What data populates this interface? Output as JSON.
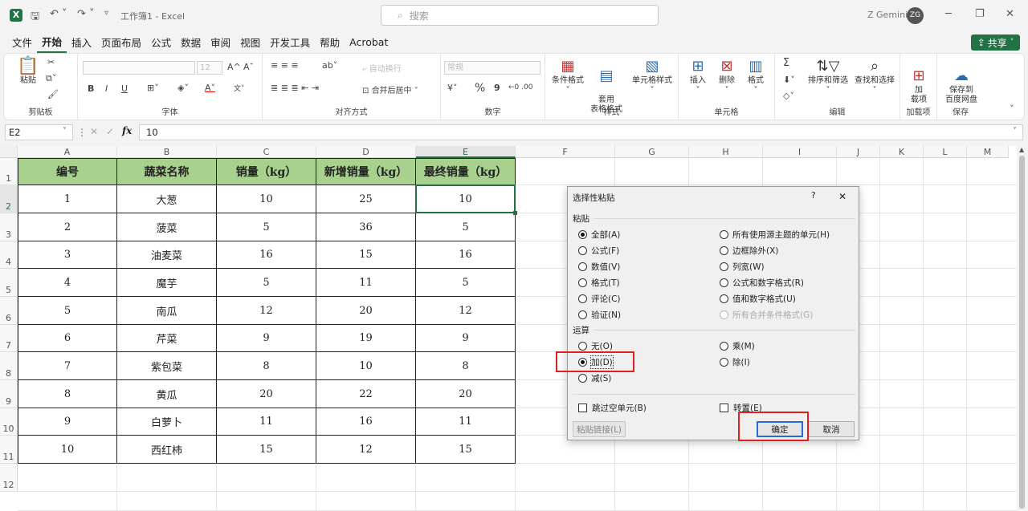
{
  "app": {
    "title": "工作簿1 - Excel",
    "search_placeholder": "搜索",
    "user_name": "Z Gemini",
    "user_initials": "ZG"
  },
  "menu": {
    "items": [
      "文件",
      "开始",
      "插入",
      "页面布局",
      "公式",
      "数据",
      "审阅",
      "视图",
      "开发工具",
      "帮助",
      "Acrobat"
    ],
    "active": "开始",
    "share": "共享"
  },
  "ribbon": {
    "clipboard": {
      "paste": "粘贴",
      "label": "剪贴板"
    },
    "font": {
      "size": "12",
      "label": "字体",
      "bold": "B",
      "italic": "I",
      "underline": "U",
      "increase": "A^",
      "decrease": "Aˇ"
    },
    "align": {
      "wrap": "自动换行",
      "merge": "合并后居中",
      "label": "对齐方式"
    },
    "number": {
      "format": "常规",
      "label": "数字",
      "percent": "%",
      "comma": "9"
    },
    "styles": {
      "cond": "条件格式",
      "table": "套用\n表格格式",
      "cell": "单元格样式",
      "label": "样式"
    },
    "cells": {
      "insert": "插入",
      "delete": "删除",
      "format": "格式",
      "label": "单元格"
    },
    "edit": {
      "sort": "排序和筛选",
      "find": "查找和选择",
      "label": "编辑",
      "sum": "Σ"
    },
    "addins": {
      "add": "加\n载项",
      "label": "加载项"
    },
    "save": {
      "save": "保存到\n百度网盘",
      "label": "保存"
    }
  },
  "formula": {
    "name": "E2",
    "value": "10",
    "fx": "fx"
  },
  "sheet": {
    "columns": [
      "A",
      "B",
      "C",
      "D",
      "E",
      "F",
      "G",
      "H",
      "I",
      "J",
      "K",
      "L",
      "M"
    ],
    "rows": [
      "1",
      "2",
      "3",
      "4",
      "5",
      "6",
      "7",
      "8",
      "9",
      "10",
      "11",
      "12"
    ],
    "headers": [
      "编号",
      "蔬菜名称",
      "销量（kg）",
      "新增销量（kg）",
      "最终销量（kg）"
    ],
    "data": [
      [
        "1",
        "大葱",
        "10",
        "25",
        "10"
      ],
      [
        "2",
        "菠菜",
        "5",
        "36",
        "5"
      ],
      [
        "3",
        "油麦菜",
        "16",
        "15",
        "16"
      ],
      [
        "4",
        "魔芋",
        "5",
        "11",
        "5"
      ],
      [
        "5",
        "南瓜",
        "12",
        "20",
        "12"
      ],
      [
        "6",
        "芹菜",
        "9",
        "19",
        "9"
      ],
      [
        "7",
        "紫包菜",
        "8",
        "10",
        "8"
      ],
      [
        "8",
        "黄瓜",
        "20",
        "22",
        "20"
      ],
      [
        "9",
        "白萝卜",
        "11",
        "16",
        "11"
      ],
      [
        "10",
        "西红柿",
        "15",
        "12",
        "15"
      ]
    ],
    "selected_cell": "E2"
  },
  "dialog": {
    "title": "选择性粘贴",
    "help": "?",
    "close": "✕",
    "paste_label": "粘贴",
    "paste_left": [
      "全部(A)",
      "公式(F)",
      "数值(V)",
      "格式(T)",
      "评论(C)",
      "验证(N)"
    ],
    "paste_right": [
      "所有使用源主题的单元(H)",
      "边框除外(X)",
      "列宽(W)",
      "公式和数字格式(R)",
      "值和数字格式(U)",
      "所有合并条件格式(G)"
    ],
    "op_label": "运算",
    "op_left": [
      "无(O)",
      "加(D)",
      "减(S)"
    ],
    "op_right": [
      "乘(M)",
      "除(I)"
    ],
    "skip_blanks": "跳过空单元(B)",
    "transpose": "转置(E)",
    "paste_link": "粘贴链接(L)",
    "ok": "确定",
    "cancel": "取消"
  }
}
